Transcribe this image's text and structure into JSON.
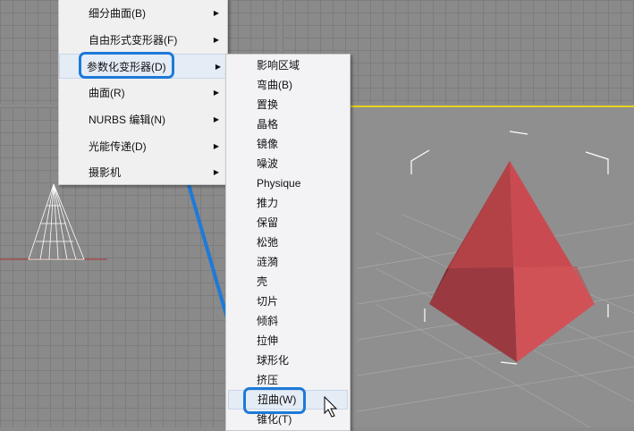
{
  "main_menu": {
    "items": [
      {
        "label": "细分曲面(B)"
      },
      {
        "label": "自由形式变形器(F)"
      },
      {
        "label": "参数化变形器(D)",
        "selected": true
      },
      {
        "label": "曲面(R)"
      },
      {
        "label": "NURBS 编辑(N)"
      },
      {
        "label": "光能传递(D)"
      },
      {
        "label": "摄影机"
      }
    ],
    "submenu_arrow": "▶"
  },
  "sub_menu": {
    "items": [
      {
        "label": "影响区域"
      },
      {
        "label": "弯曲(B)"
      },
      {
        "label": "置换"
      },
      {
        "label": "晶格"
      },
      {
        "label": "镜像"
      },
      {
        "label": "噪波"
      },
      {
        "label": "Physique"
      },
      {
        "label": "推力"
      },
      {
        "label": "保留"
      },
      {
        "label": "松弛"
      },
      {
        "label": "涟漪"
      },
      {
        "label": "壳"
      },
      {
        "label": "切片"
      },
      {
        "label": "倾斜"
      },
      {
        "label": "拉伸"
      },
      {
        "label": "球形化"
      },
      {
        "label": "挤压"
      },
      {
        "label": "扭曲(W)",
        "selected": true
      },
      {
        "label": "锥化(T)"
      }
    ]
  },
  "colors": {
    "highlight": "#1d7ad8",
    "viewport_active": "#e8d21c",
    "pyramid": "#c94a4f"
  }
}
